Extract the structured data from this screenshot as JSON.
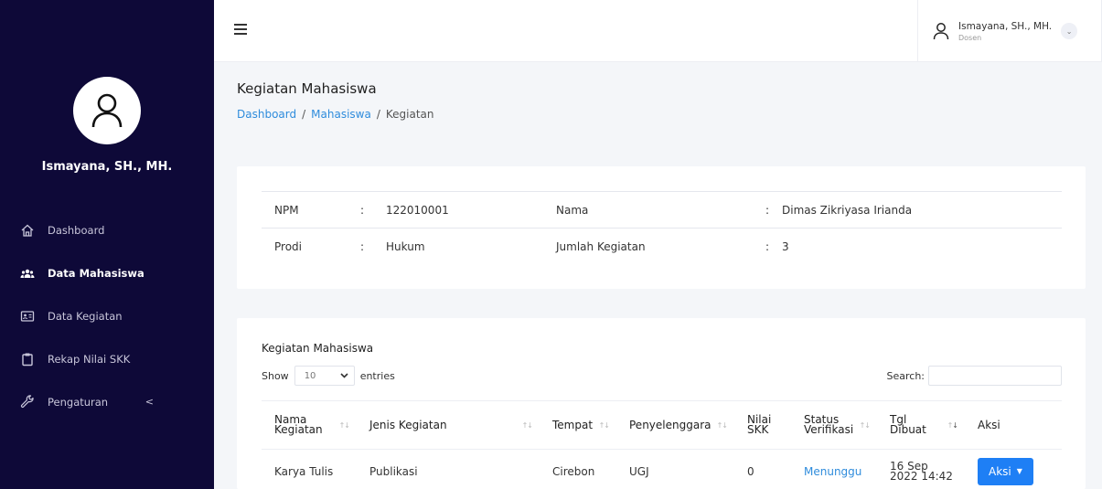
{
  "sidebar": {
    "profile_name": "Ismayana, SH., MH.",
    "items": [
      {
        "label": "Dashboard",
        "icon": "home-icon"
      },
      {
        "label": "Data Mahasiswa",
        "icon": "users-icon",
        "active": true
      },
      {
        "label": "Data Kegiatan",
        "icon": "id-card-icon"
      },
      {
        "label": "Rekap Nilai SKK",
        "icon": "clipboard-icon"
      },
      {
        "label": "Pengaturan",
        "icon": "wrench-icon",
        "chevron": "<"
      }
    ]
  },
  "topbar": {
    "user_name": "Ismayana, SH., MH.",
    "user_role": "Dosen"
  },
  "page": {
    "title": "Kegiatan Mahasiswa",
    "breadcrumb": [
      "Dashboard",
      "Mahasiswa",
      "Kegiatan"
    ],
    "breadcrumb_sep": "/"
  },
  "info": {
    "colon": ":",
    "npm_label": "NPM",
    "npm_value": "122010001",
    "nama_label": "Nama",
    "nama_value": "Dimas Zikriyasa Irianda",
    "prodi_label": "Prodi",
    "prodi_value": "Hukum",
    "jumlah_label": "Jumlah Kegiatan",
    "jumlah_value": "3"
  },
  "list": {
    "title": "Kegiatan Mahasiswa",
    "show_label": "Show",
    "entries_value": "10",
    "entries_label": "entries",
    "search_label": "Search:",
    "columns": [
      {
        "line1": "Nama",
        "line2": "Kegiatan"
      },
      {
        "line1": "Jenis Kegiatan",
        "line2": ""
      },
      {
        "line1": "Tempat",
        "line2": ""
      },
      {
        "line1": "Penyelenggara",
        "line2": ""
      },
      {
        "line1": "Nilai",
        "line2": "SKK"
      },
      {
        "line1": "Status",
        "line2": "Verifikasi"
      },
      {
        "line1": "Tgl",
        "line2": "Dibuat"
      },
      {
        "line1": "Aksi",
        "line2": ""
      }
    ],
    "rows": [
      {
        "nama": "Karya Tulis",
        "jenis": "Publikasi",
        "tempat": "Cirebon",
        "penyelenggara": "UGJ",
        "nilai": "0",
        "status": "Menunggu",
        "tgl_line1": "16 Sep",
        "tgl_line2": "2022 14:42",
        "aksi": "Aksi"
      }
    ]
  },
  "colors": {
    "sidebar_bg": "#0e0938",
    "accent": "#1e7ff5",
    "link": "#2f8cdc"
  }
}
